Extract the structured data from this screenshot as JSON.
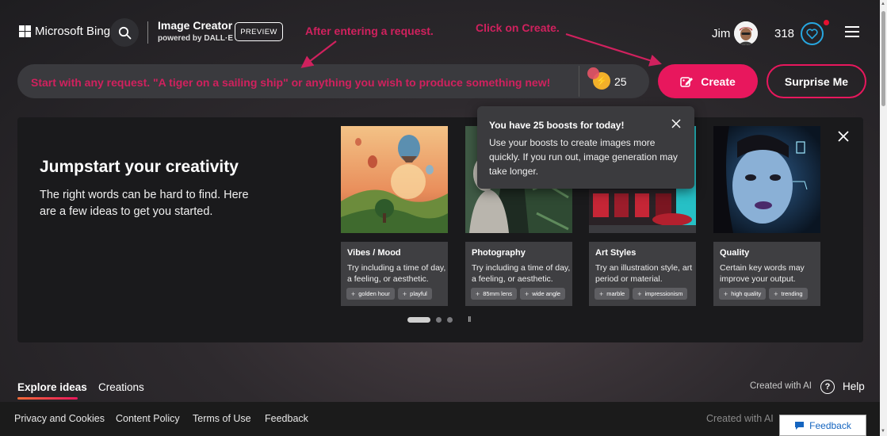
{
  "header": {
    "logo_text": "Microsoft Bing",
    "app_title": "Image Creator",
    "app_subtitle": "powered by DALL·E",
    "preview_label": "PREVIEW",
    "user_name": "Jim",
    "reward_points": "318"
  },
  "prompt": {
    "placeholder": "Start with any request. \"A tiger on a sailing ship\" or anything you wish to produce something new!",
    "boost_count": "25",
    "create_label": "Create",
    "surprise_label": "Surprise Me"
  },
  "annotations": {
    "request_note": "After entering a request.",
    "create_note": "Click on Create."
  },
  "jumpstart": {
    "title": "Jumpstart your creativity",
    "description": "The right words can be hard to find. Here are a few ideas to get you started.",
    "cards": [
      {
        "title": "Vibes / Mood",
        "description": "Try including a time of day, a feeling, or aesthetic.",
        "chips": [
          "golden hour",
          "playful"
        ]
      },
      {
        "title": "Photography",
        "description": "Try including a time of day, a feeling, or aesthetic.",
        "chips": [
          "85mm lens",
          "wide angle"
        ]
      },
      {
        "title": "Art Styles",
        "description": "Try an illustration style, art period or material.",
        "chips": [
          "marble",
          "impressionism"
        ]
      },
      {
        "title": "Quality",
        "description": "Certain key words may improve your output.",
        "chips": [
          "high quality",
          "trending"
        ]
      }
    ],
    "pause_symbol": "II"
  },
  "tooltip": {
    "title": "You have 25 boosts for today!",
    "text": "Use your boosts to create images more quickly. If you run out, image generation may take longer."
  },
  "tabs": {
    "explore": "Explore ideas",
    "creations": "Creations",
    "created_with_ai": "Created with AI",
    "help": "Help"
  },
  "footer": {
    "links": [
      "Privacy and Cookies",
      "Content Policy",
      "Terms of Use",
      "Feedback"
    ],
    "created_with_ai": "Created with AI",
    "feedback_button": "Feedback"
  },
  "colors": {
    "accent": "#e8175d",
    "annotation": "#d0215e",
    "panel": "#1a1a1c"
  }
}
